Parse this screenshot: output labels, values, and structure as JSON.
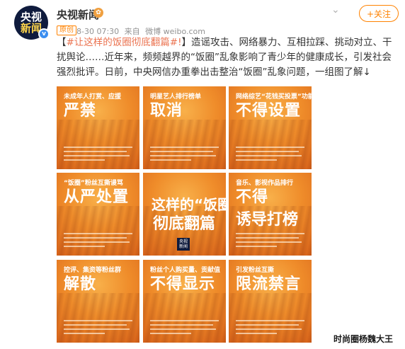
{
  "author": {
    "name": "央视新闻",
    "avatar_top": "央视",
    "avatar_bottom": "新闻",
    "verified_mark": "v",
    "badge_glyph": "✿"
  },
  "post": {
    "tag": "原创",
    "time": "8-30 07:30",
    "source_prefix": "来自",
    "source": "微博 weibo.com",
    "text_open": "【",
    "hashtag": "#让这样的饭圈彻底翻篇#!",
    "text_rest": "】造谣攻击、网络暴力、互相拉踩、挑动对立、干扰舆论……近年来，频频越界的“饭圈”乱象影响了青少年的健康成长，引发社会强烈批评。日前，中央网信办重拳出击整治“饭圈”乱象问题，一组图了解↓"
  },
  "actions": {
    "follow_label": "+关注",
    "chevron": "⌄"
  },
  "tiles": [
    {
      "small": "未成年人打赏、应援",
      "big": "严禁"
    },
    {
      "small": "明星艺人排行榜单",
      "big": "取消"
    },
    {
      "small": "网络综艺“花钱买投票”功能",
      "big": "不得设置"
    },
    {
      "small": "“饭圈”粉丝互撕谩骂",
      "big": "从严处置"
    },
    {
      "small": "",
      "big": "这样的“饭圈”",
      "big2": "彻底翻篇",
      "logo_top": "央视",
      "logo_bottom": "新闻"
    },
    {
      "small": "音乐、影视作品排行",
      "big": "不得",
      "big2": "诱导打榜"
    },
    {
      "small": "控评、集资等粉丝群",
      "big": "解散"
    },
    {
      "small": "粉丝个人购买量、贡献值",
      "big": "不得显示"
    },
    {
      "small": "引发粉丝互撕",
      "big": "限流禁言"
    }
  ],
  "watermark": "时尚圈杨魏大王",
  "colors": {
    "accent_orange": "#ff8200",
    "hashtag": "#eb7350",
    "tile_orange": "#ef8c2a"
  }
}
